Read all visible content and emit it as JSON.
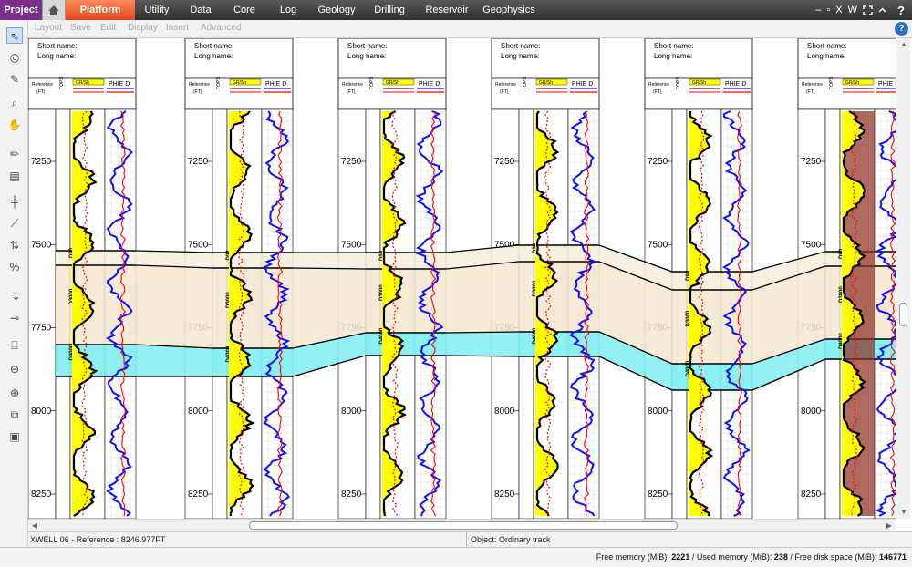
{
  "menubar": {
    "project": "Project",
    "tabs": [
      "Platform",
      "Utility",
      "Data",
      "Core",
      "Log",
      "Geology",
      "Drilling",
      "Reservoir",
      "Geophysics"
    ],
    "active_tab": "Platform",
    "window_controls": [
      "–",
      "▫",
      "X",
      "W"
    ],
    "help": "?"
  },
  "subbar": {
    "items": [
      "Layout",
      "Save",
      "Edit",
      "Display",
      "Insert",
      "Advanced"
    ],
    "help_label": "?"
  },
  "palette": {
    "tools": [
      "pointer-icon",
      "target-icon",
      "eraser-icon",
      "zoom-icon",
      "pan-hand-icon",
      "pencil-icon",
      "document-icon",
      "add-track-icon",
      "ruler-icon",
      "flip-icon",
      "percent-icon",
      "marker-icon",
      "line-icon",
      "align-icon",
      "center-icon",
      "crosshair-icon",
      "stack-icon",
      "page-icon"
    ]
  },
  "wells": {
    "short_name_label": "Short name:",
    "long_name_label": "Long name:",
    "ref_label": "Reference",
    "ref_unit": "(FT)",
    "tops_label": "TOPS",
    "gr_label": "GR/Sh",
    "phie_label": "PHIE D",
    "depth_ticks": [
      "7250",
      "7500",
      "7750",
      "8000",
      "8250"
    ],
    "depth_values": [
      7250,
      7500,
      7750,
      8000,
      8250
    ],
    "zones": [
      "D90",
      "D3000",
      "D4000"
    ]
  },
  "status": {
    "reference": "XWELL 06 - Reference : 8246.977FT",
    "object": "Object: Ordinary track"
  },
  "memory": {
    "free_label": "Free memory (MiB):",
    "free_value": "2221",
    "used_label": "/ Used memory (MiB):",
    "used_value": "238",
    "disk_label": "/ Free disk space (MiB):",
    "disk_value": "146771"
  },
  "colors": {
    "accent_tab": "#e8551f",
    "project_tab": "#7a2e8e",
    "gamma_fill": "#ffff00",
    "gamma_curve": "#000000",
    "red_curve": "#ff0000",
    "phie_curve": "#1010ff",
    "zone_d90": "#f6efdc",
    "zone_d3000": "#f5e7d0",
    "zone_d4000": "#80eef2",
    "shale_fill": "#8b2b1e"
  }
}
